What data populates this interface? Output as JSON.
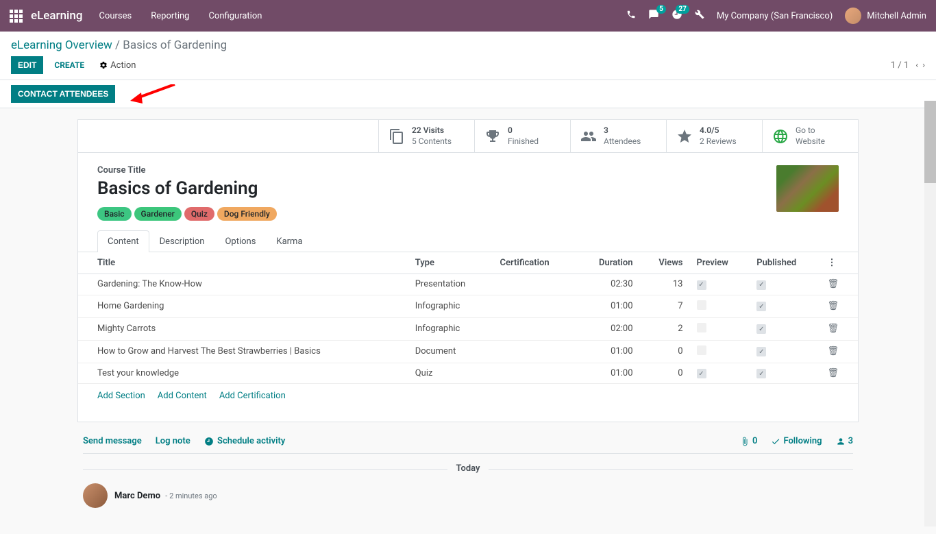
{
  "topnav": {
    "brand": "eLearning",
    "menu": [
      "Courses",
      "Reporting",
      "Configuration"
    ],
    "chat_count": "5",
    "clock_count": "27",
    "company": "My Company (San Francisco)",
    "user": "Mitchell Admin"
  },
  "breadcrumb": {
    "root": "eLearning Overview",
    "current": "Basics of Gardening"
  },
  "actions": {
    "edit": "EDIT",
    "create": "CREATE",
    "action_label": "Action"
  },
  "pager": {
    "text": "1 / 1"
  },
  "status": {
    "contact_attendees": "CONTACT ATTENDEES"
  },
  "stats": {
    "visits_n": "22 Visits",
    "visits_sub": "5 Contents",
    "finished_n": "0",
    "finished_sub": "Finished",
    "attendees_n": "3",
    "attendees_sub": "Attendees",
    "reviews_n": "4.0/5",
    "reviews_sub": "2 Reviews",
    "website_a": "Go to",
    "website_b": "Website"
  },
  "course": {
    "label": "Course Title",
    "title": "Basics of Gardening",
    "tags": [
      {
        "text": "Basic",
        "class": "tag-green"
      },
      {
        "text": "Gardener",
        "class": "tag-green2"
      },
      {
        "text": "Quiz",
        "class": "tag-red"
      },
      {
        "text": "Dog Friendly",
        "class": "tag-orange"
      }
    ]
  },
  "tabs": [
    "Content",
    "Description",
    "Options",
    "Karma"
  ],
  "table": {
    "headers": {
      "title": "Title",
      "type": "Type",
      "certification": "Certification",
      "duration": "Duration",
      "views": "Views",
      "preview": "Preview",
      "published": "Published"
    },
    "rows": [
      {
        "title": "Gardening: The Know-How",
        "type": "Presentation",
        "duration": "02:30",
        "views": "13",
        "preview": true,
        "published": true
      },
      {
        "title": "Home Gardening",
        "type": "Infographic",
        "duration": "01:00",
        "views": "7",
        "preview": false,
        "published": true
      },
      {
        "title": "Mighty Carrots",
        "type": "Infographic",
        "duration": "02:00",
        "views": "2",
        "preview": false,
        "published": true
      },
      {
        "title": "How to Grow and Harvest The Best Strawberries | Basics",
        "type": "Document",
        "duration": "01:00",
        "views": "0",
        "preview": false,
        "published": true
      },
      {
        "title": "Test your knowledge",
        "type": "Quiz",
        "duration": "01:00",
        "views": "0",
        "preview": true,
        "published": true
      }
    ],
    "actions": {
      "add_section": "Add Section",
      "add_content": "Add Content",
      "add_certification": "Add Certification"
    }
  },
  "chatter": {
    "send": "Send message",
    "log": "Log note",
    "schedule": "Schedule activity",
    "attach_n": "0",
    "following": "Following",
    "followers_n": "3",
    "today": "Today",
    "msg_author": "Marc Demo",
    "msg_time": "- 2 minutes ago"
  }
}
